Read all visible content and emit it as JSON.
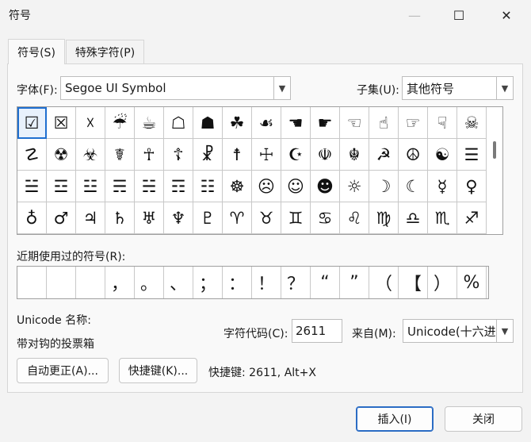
{
  "window": {
    "title": "符号",
    "minimize": "—",
    "maximize": "☐",
    "close": "✕"
  },
  "tabs": [
    {
      "label": "符号(S)"
    },
    {
      "label": "特殊字符(P)"
    }
  ],
  "font": {
    "label": "字体(F):",
    "value": "Segoe UI Symbol"
  },
  "subset": {
    "label": "子集(U):",
    "value": "其他符号"
  },
  "symbols": [
    [
      "☑",
      "☒",
      "☓",
      "☔",
      "☕",
      "☖",
      "☗",
      "☘",
      "☙",
      "☚",
      "☛",
      "☜",
      "☝",
      "☞",
      "☟",
      "☠"
    ],
    [
      "☡",
      "☢",
      "☣",
      "☤",
      "☥",
      "☦",
      "☧",
      "☨",
      "☩",
      "☪",
      "☫",
      "☬",
      "☭",
      "☮",
      "☯",
      "☰"
    ],
    [
      "☱",
      "☲",
      "☳",
      "☴",
      "☵",
      "☶",
      "☷",
      "☸",
      "☹",
      "☺",
      "☻",
      "☼",
      "☽",
      "☾",
      "☿",
      "♀"
    ],
    [
      "♁",
      "♂",
      "♃",
      "♄",
      "♅",
      "♆",
      "♇",
      "♈",
      "♉",
      "♊",
      "♋",
      "♌",
      "♍",
      "♎",
      "♏",
      "♐"
    ]
  ],
  "recent": {
    "label": "近期使用过的符号(R):",
    "items": [
      "",
      "",
      "",
      "，",
      "。",
      "、",
      "；",
      "：",
      "！",
      "？",
      "“",
      "”",
      "（",
      "【",
      "）",
      "%"
    ]
  },
  "unicode_name": {
    "label": "Unicode 名称:",
    "value": "带对钩的投票箱"
  },
  "char_code": {
    "label": "字符代码(C):",
    "value": "2611"
  },
  "from": {
    "label": "来自(M):",
    "value": "Unicode(十六进制)"
  },
  "buttons": {
    "autocorrect": "自动更正(A)...",
    "shortcut_key": "快捷键(K)...",
    "insert": "插入(I)",
    "close": "关闭"
  },
  "shortcut_text": "快捷键: 2611, Alt+X"
}
